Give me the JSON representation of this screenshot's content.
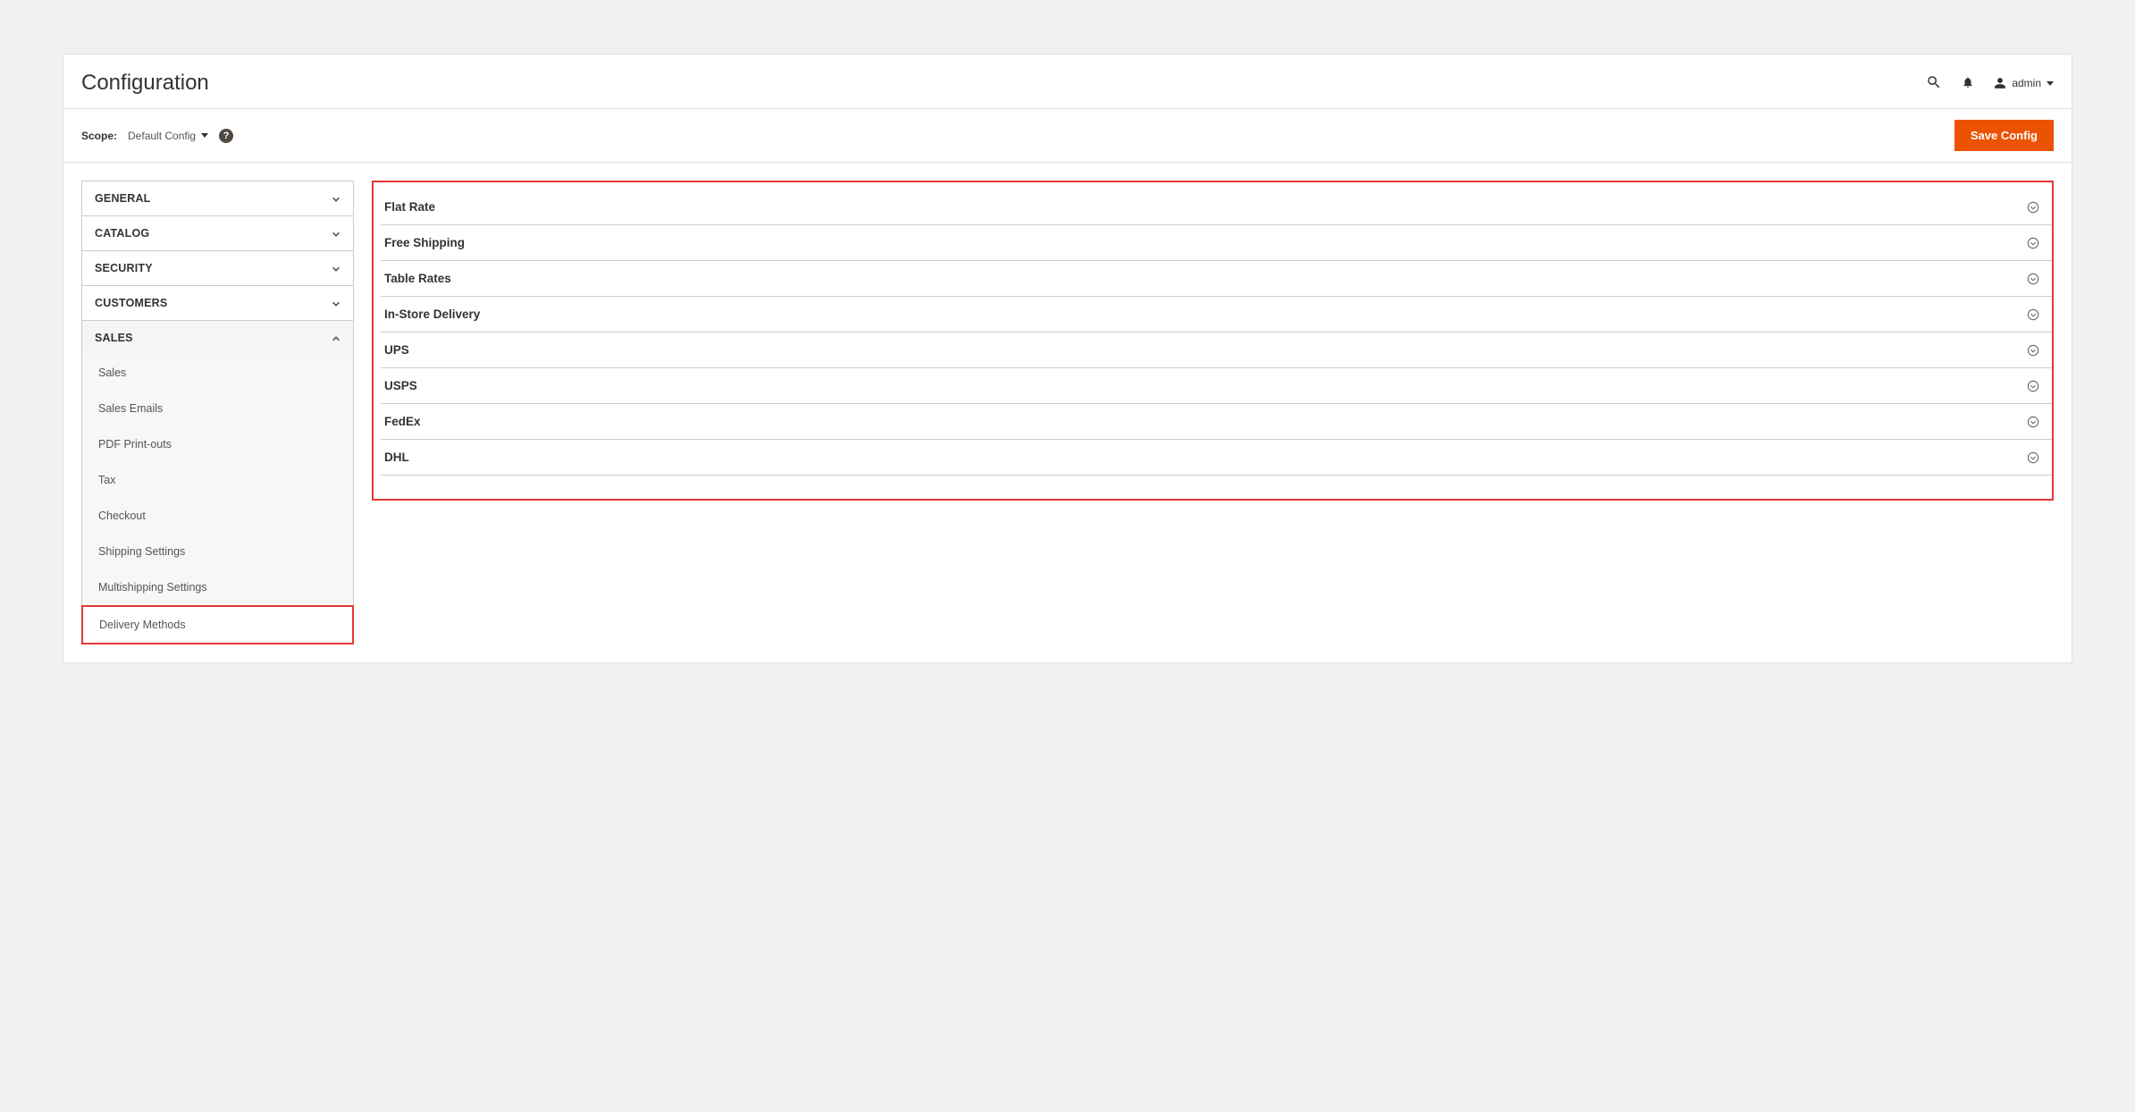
{
  "header": {
    "title": "Configuration",
    "user_label": "admin"
  },
  "scope": {
    "label": "Scope:",
    "value": "Default Config"
  },
  "save_button": "Save Config",
  "nav": [
    {
      "label": "GENERAL",
      "expanded": false
    },
    {
      "label": "CATALOG",
      "expanded": false
    },
    {
      "label": "SECURITY",
      "expanded": false
    },
    {
      "label": "CUSTOMERS",
      "expanded": false
    },
    {
      "label": "SALES",
      "expanded": true
    }
  ],
  "sales_sub": [
    {
      "label": "Sales"
    },
    {
      "label": "Sales Emails"
    },
    {
      "label": "PDF Print-outs"
    },
    {
      "label": "Tax"
    },
    {
      "label": "Checkout"
    },
    {
      "label": "Shipping Settings"
    },
    {
      "label": "Multishipping Settings"
    },
    {
      "label": "Delivery Methods",
      "active": true
    }
  ],
  "methods": [
    {
      "label": "Flat Rate"
    },
    {
      "label": "Free Shipping"
    },
    {
      "label": "Table Rates"
    },
    {
      "label": "In-Store Delivery"
    },
    {
      "label": "UPS"
    },
    {
      "label": "USPS"
    },
    {
      "label": "FedEx"
    },
    {
      "label": "DHL"
    }
  ]
}
